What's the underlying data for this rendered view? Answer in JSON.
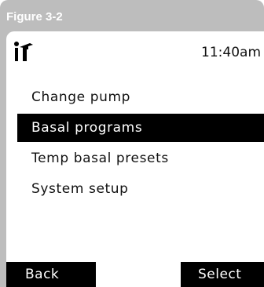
{
  "figure_label": "Figure 3-2",
  "status_bar": {
    "time": "11:40am",
    "logo_icon": "pump-logo-icon"
  },
  "menu": {
    "items": [
      {
        "label": "Change pump",
        "selected": false
      },
      {
        "label": "Basal programs",
        "selected": true
      },
      {
        "label": "Temp basal presets",
        "selected": false
      },
      {
        "label": "System setup",
        "selected": false
      }
    ]
  },
  "softkeys": {
    "left": "Back",
    "right": "Select"
  },
  "colors": {
    "frame": "#bdbdbd",
    "screen": "#ffffff",
    "highlight": "#000000",
    "highlight_text": "#ffffff"
  }
}
